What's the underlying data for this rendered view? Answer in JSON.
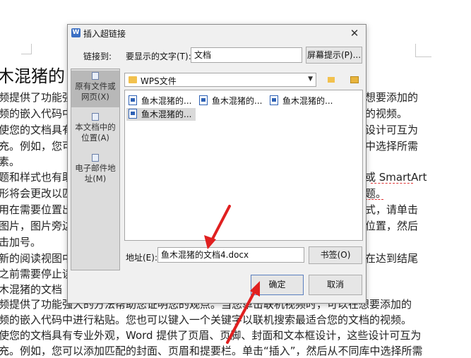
{
  "document": {
    "title": "木混猪的",
    "lines": [
      "频提供了功能强",
      "频的嵌入代码中",
      "使您的文档具有",
      "充。例如，您可",
      "素。",
      "题和样式也有助",
      "形将会更改以匹",
      "用在需要位置出",
      "图片，图片旁边",
      "击加号。",
      "新的阅读视图中",
      "之前需要停止读",
      "木混猪的文档",
      "频提供了功能强大的方法帮助您证明您的观点。当您单击联机视频时，可以在想要添加的",
      "频的嵌入代码中进行粘贴。您也可以键入一个关键字以联机搜索最适合您的文档的视频。",
      "使您的文档具有专业外观，Word 提供了页眉、页脚、封面和文本框设计，这些设计可互为",
      "充。例如，您可以添加匹配的封面、页眉和提要栏。单击“插入”，然后从不同库中选择所需"
    ],
    "right_fragments": [
      "想要添加的",
      "的视频。",
      "设计可互为",
      "中选择所需",
      "或 SmartArt",
      "题。",
      "式，请单击",
      "位置，然后",
      "在达到结尾"
    ]
  },
  "dialog": {
    "title": "插入超链接",
    "link_to_label": "链接到:",
    "display_text_label": "要显示的文字(T):",
    "display_text_value": "文档",
    "screen_tip_button": "屏幕提示(P)...",
    "sidebar": [
      {
        "label": "原有文件或网页(X)"
      },
      {
        "label": "本文档中的位置(A)"
      },
      {
        "label": "电子邮件地址(M)"
      }
    ],
    "current_folder": "WPS文件",
    "files": [
      "鱼木混猪的...",
      "鱼木混猪的...",
      "鱼木混猪的...",
      "鱼木混猪的..."
    ],
    "address_label": "地址(E):",
    "address_value": "鱼木混猪的文档4.docx",
    "bookmark_button": "书签(O)",
    "ok_button": "确定",
    "cancel_button": "取消"
  },
  "colors": {
    "annotation_arrow": "#e02020",
    "dialog_bg": "#f0f0f0",
    "sidebar_bg": "#dcdcdc",
    "selected_item": "#d9d9d9"
  }
}
